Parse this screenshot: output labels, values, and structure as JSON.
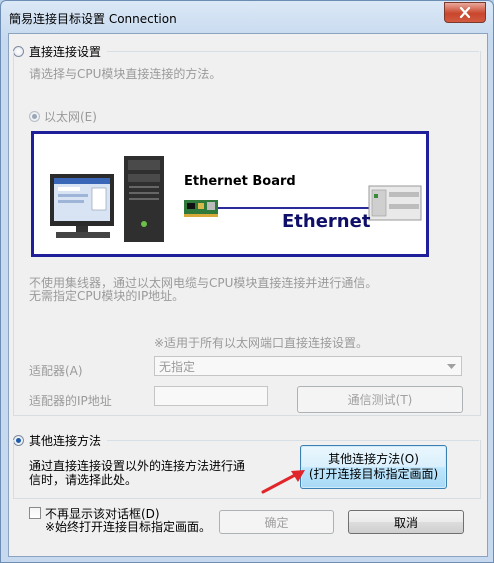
{
  "window": {
    "title": "簡易连接目标设置 Connection"
  },
  "direct": {
    "label": "直接连接设置",
    "hint": "请选择与CPU模块直接连接的方法。",
    "ethernet_label": "以太网(E)",
    "ethernet_board_label": "Ethernet Board",
    "ethernet_label_big": "Ethernet",
    "desc_line1": "不使用集线器，通过以太网电缆与CPU模块直接连接并进行通信。",
    "desc_line2": "无需指定CPU模块的IP地址。",
    "note": "※适用于所有以太网端口直接连接设置。",
    "adapter_label": "适配器(A)",
    "adapter_value": "无指定",
    "ip_label": "适配器的IP地址",
    "ip_value": "",
    "test_button": "通信测试(T)"
  },
  "other": {
    "label": "其他连接方法",
    "desc_line1": "通过直接连接设置以外的连接方法进行通",
    "desc_line2": "信时，请选择此处。",
    "button_line1": "其他连接方法(O)",
    "button_line2": "(打开连接目标指定画面)"
  },
  "footer": {
    "checkbox_label": "不再显示该对话框(D)",
    "checkbox_note": "※始终打开连接目标指定画面。",
    "ok_button": "确定",
    "cancel_button": "取消"
  },
  "colors": {
    "diagram_border": "#1f1f9a",
    "arrow": "#e0262a",
    "hot_button_border": "#3c7fb1"
  },
  "icons": [
    "close-icon",
    "pc-icon",
    "network-card-icon",
    "plc-icon",
    "red-arrow-icon",
    "dropdown-arrow-icon"
  ]
}
